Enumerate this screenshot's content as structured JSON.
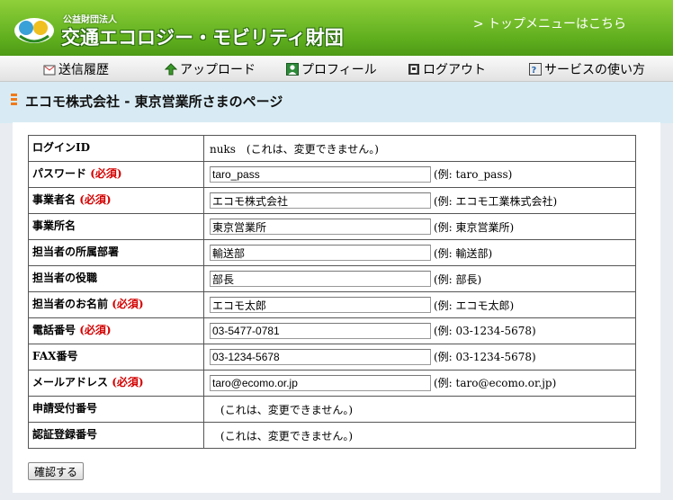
{
  "header": {
    "org_type": "公益財団法人",
    "org_name": "交通エコロジー・モビリティ財団",
    "top_link": "> トップメニューはこちら"
  },
  "nav": {
    "items": [
      {
        "label": "送信履歴",
        "icon": "send-history-icon"
      },
      {
        "label": "アップロード",
        "icon": "upload-icon"
      },
      {
        "label": "プロフィール",
        "icon": "profile-icon"
      },
      {
        "label": "ログアウト",
        "icon": "logout-icon"
      },
      {
        "label": "サービスの使い方",
        "icon": "help-icon"
      }
    ]
  },
  "page": {
    "title": "エコモ株式会社 - 東京営業所さまのページ"
  },
  "form": {
    "required_mark": "(必須)",
    "rows": {
      "login_id": {
        "label": "ログインID",
        "value": "nuks",
        "note": "(これは、変更できません。)"
      },
      "password": {
        "label": "パスワード",
        "value": "taro_pass",
        "example": "(例: taro_pass)"
      },
      "company": {
        "label": "事業者名",
        "value": "エコモ株式会社",
        "example": "(例: エコモ工業株式会社)"
      },
      "office": {
        "label": "事業所名",
        "value": "東京営業所",
        "example": "(例: 東京営業所)"
      },
      "department": {
        "label": "担当者の所属部署",
        "value": "輸送部",
        "example": "(例: 輸送部)"
      },
      "position": {
        "label": "担当者の役職",
        "value": "部長",
        "example": "(例: 部長)"
      },
      "person_name": {
        "label": "担当者のお名前",
        "value": "エコモ太郎",
        "example": "(例: エコモ太郎)"
      },
      "phone": {
        "label": "電話番号",
        "value": "03-5477-0781",
        "example": "(例: 03-1234-5678)"
      },
      "fax": {
        "label": "FAX番号",
        "value": "03-1234-5678",
        "example": "(例: 03-1234-5678)"
      },
      "email": {
        "label": "メールアドレス",
        "value": "taro@ecomo.or.jp",
        "example": "(例: taro@ecomo.or.jp)"
      },
      "application_no": {
        "label": "申請受付番号",
        "note": "(これは、変更できません。)"
      },
      "certification_no": {
        "label": "認証登録番号",
        "note": "(これは、変更できません。)"
      }
    },
    "submit_label": "確認する"
  },
  "colors": {
    "header_green": "#5fae1e",
    "accent_orange": "#f07a1a",
    "required_red": "#d40000",
    "page_bg": "#d8ebf4"
  }
}
